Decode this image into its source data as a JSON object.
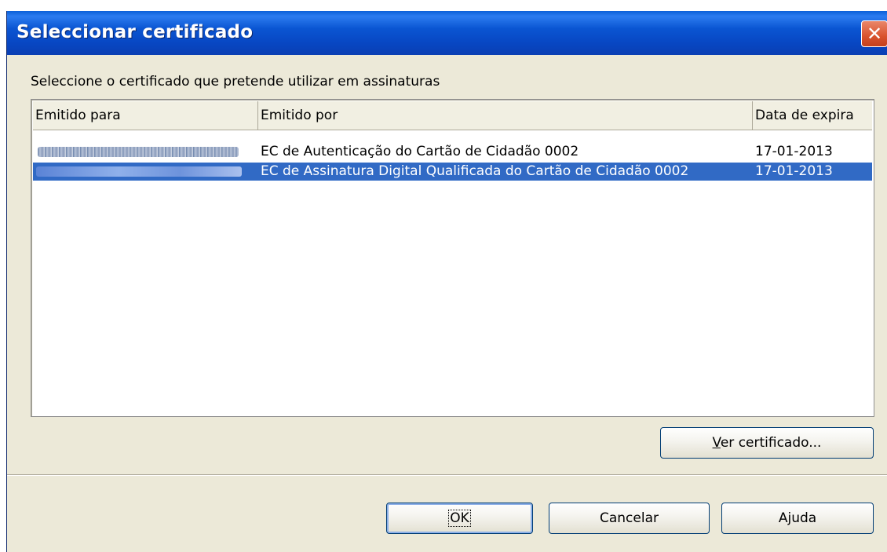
{
  "window": {
    "title": "Seleccionar certificado",
    "close_glyph": "✕"
  },
  "prompt": "Seleccione o certificado que pretende utilizar em assinaturas",
  "table": {
    "columns": [
      "Emitido para",
      "Emitido por",
      "Data de expira"
    ],
    "rows": [
      {
        "issued_to": "",
        "issued_by": "EC de Autenticação do Cartão de Cidadão 0002",
        "expiry": "17-01-2013",
        "selected": false
      },
      {
        "issued_to": "",
        "issued_by": "EC de Assinatura Digital Qualificada do Cartão de Cidadão 0002",
        "expiry": "17-01-2013",
        "selected": true
      }
    ]
  },
  "buttons": {
    "view_certificate": {
      "accel": "V",
      "rest": "er certificado..."
    },
    "ok": "OK",
    "cancel": "Cancelar",
    "help": {
      "before": "A",
      "accel": "j",
      "after": "uda"
    }
  },
  "colors": {
    "titlebar": "#0a55d2",
    "selection": "#316ac5",
    "close_button": "#d9532e",
    "dialog_bg": "#ece9d8"
  }
}
